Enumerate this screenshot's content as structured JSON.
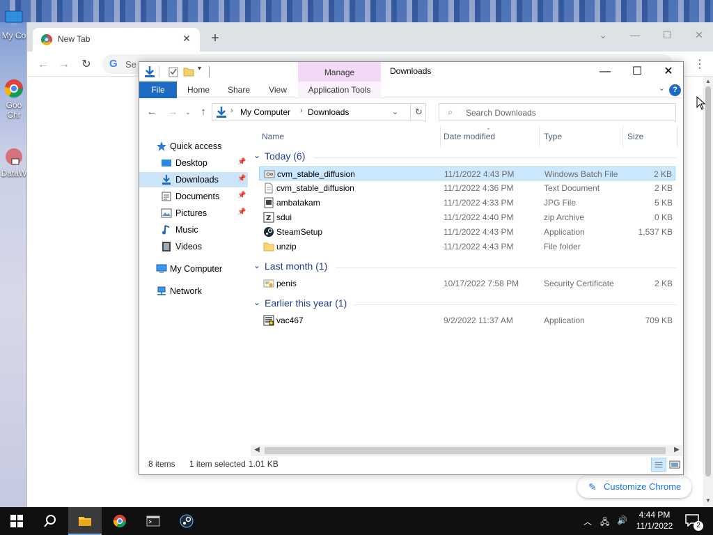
{
  "desktop": {
    "icons": [
      {
        "label": "My Co",
        "icon": "computer-icon"
      },
      {
        "label": "Goo Chr",
        "icon": "chrome-icon"
      },
      {
        "label": "DataW",
        "icon": "app-icon"
      }
    ]
  },
  "chrome": {
    "tab_title": "New Tab",
    "omnibox_placeholder": "Se",
    "customize_label": "Customize Chrome"
  },
  "explorer": {
    "title": "Downloads",
    "manage_label": "Manage",
    "ribbon_tabs": [
      "File",
      "Home",
      "Share",
      "View",
      "Application Tools"
    ],
    "breadcrumb": [
      "My Computer",
      "Downloads"
    ],
    "search_placeholder": "Search Downloads",
    "nav": [
      {
        "label": "Quick access",
        "icon": "star-icon",
        "pinned": false,
        "selected": false
      },
      {
        "label": "Desktop",
        "icon": "desktop-icon",
        "pinned": true,
        "selected": false
      },
      {
        "label": "Downloads",
        "icon": "download-icon",
        "pinned": true,
        "selected": true
      },
      {
        "label": "Documents",
        "icon": "document-icon",
        "pinned": true,
        "selected": false
      },
      {
        "label": "Pictures",
        "icon": "picture-icon",
        "pinned": true,
        "selected": false
      },
      {
        "label": "Music",
        "icon": "music-icon",
        "pinned": false,
        "selected": false
      },
      {
        "label": "Videos",
        "icon": "video-icon",
        "pinned": false,
        "selected": false
      },
      {
        "label": "My Computer",
        "icon": "computer-icon",
        "pinned": false,
        "selected": false
      },
      {
        "label": "Network",
        "icon": "network-icon",
        "pinned": false,
        "selected": false
      }
    ],
    "columns": [
      "Name",
      "Date modified",
      "Type",
      "Size"
    ],
    "groups": [
      {
        "label": "Today (6)",
        "files": [
          {
            "name": "cvm_stable_diffusion",
            "date": "11/1/2022 4:43 PM",
            "type": "Windows Batch File",
            "size": "2 KB",
            "icon": "batch-file-icon",
            "selected": true
          },
          {
            "name": "cvm_stable_diffusion",
            "date": "11/1/2022 4:36 PM",
            "type": "Text Document",
            "size": "2 KB",
            "icon": "text-file-icon",
            "selected": false
          },
          {
            "name": "ambatakam",
            "date": "11/1/2022 4:33 PM",
            "type": "JPG File",
            "size": "5 KB",
            "icon": "image-file-icon",
            "selected": false
          },
          {
            "name": "sdui",
            "date": "11/1/2022 4:40 PM",
            "type": "zip Archive",
            "size": "0 KB",
            "icon": "zip-file-icon",
            "selected": false
          },
          {
            "name": "SteamSetup",
            "date": "11/1/2022 4:43 PM",
            "type": "Application",
            "size": "1,537 KB",
            "icon": "steam-icon",
            "selected": false
          },
          {
            "name": "unzip",
            "date": "11/1/2022 4:43 PM",
            "type": "File folder",
            "size": "",
            "icon": "folder-icon",
            "selected": false
          }
        ]
      },
      {
        "label": "Last month (1)",
        "files": [
          {
            "name": "penis",
            "date": "10/17/2022 7:58 PM",
            "type": "Security Certificate",
            "size": "2 KB",
            "icon": "certificate-icon",
            "selected": false
          }
        ]
      },
      {
        "label": "Earlier this year (1)",
        "files": [
          {
            "name": "vac467",
            "date": "9/2/2022 11:37 AM",
            "type": "Application",
            "size": "709 KB",
            "icon": "application-icon",
            "selected": false
          }
        ]
      }
    ],
    "status": {
      "items": "8 items",
      "selected": "1 item selected",
      "size": "1.01 KB"
    }
  },
  "taskbar": {
    "apps": [
      "start-icon",
      "search-icon",
      "file-explorer-icon",
      "chrome-icon",
      "terminal-icon",
      "steam-icon"
    ],
    "time": "4:44 PM",
    "date": "11/1/2022",
    "notification_count": "2"
  }
}
